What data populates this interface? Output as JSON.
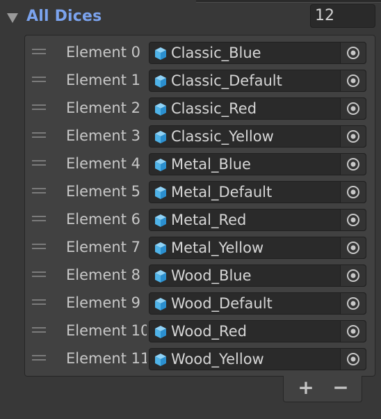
{
  "list": {
    "title": "All Dices",
    "size": "12",
    "elements": [
      {
        "label": "Element 0",
        "value": "Classic_Blue"
      },
      {
        "label": "Element 1",
        "value": "Classic_Default"
      },
      {
        "label": "Element 2",
        "value": "Classic_Red"
      },
      {
        "label": "Element 3",
        "value": "Classic_Yellow"
      },
      {
        "label": "Element 4",
        "value": "Metal_Blue"
      },
      {
        "label": "Element 5",
        "value": "Metal_Default"
      },
      {
        "label": "Element 6",
        "value": "Metal_Red"
      },
      {
        "label": "Element 7",
        "value": "Metal_Yellow"
      },
      {
        "label": "Element 8",
        "value": "Wood_Blue"
      },
      {
        "label": "Element 9",
        "value": "Wood_Default"
      },
      {
        "label": "Element 10",
        "value": "Wood_Red"
      },
      {
        "label": "Element 11",
        "value": "Wood_Yellow"
      }
    ],
    "footer": {
      "add_label": "+",
      "remove_label": "−"
    }
  },
  "icons": {
    "foldout": "triangle-down-icon",
    "drag": "drag-handle-icon",
    "asset": "prefab-cube-icon",
    "picker": "object-picker-icon"
  },
  "colors": {
    "background": "#383838",
    "title": "#7ba3ee",
    "field": "#2a2a2a",
    "cube": "#4fb3e8"
  }
}
